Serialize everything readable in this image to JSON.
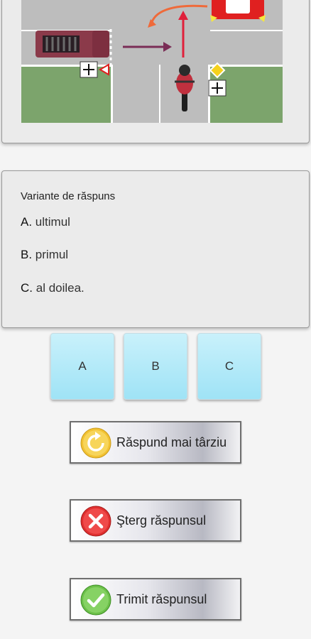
{
  "question_image": {
    "icons": [
      "truck-icon",
      "car-icon",
      "motorcycle-icon",
      "priority-road-sign-icon",
      "junction-sign-icon",
      "yield-sign-icon",
      "arrow-icon"
    ],
    "colors": {
      "road": "#bdbdbd",
      "grass": "#7ca46c",
      "truck": "#8b3a4a",
      "car": "#e02020",
      "arrow_red": "#e0203a",
      "arrow_orange": "#ef6a3a",
      "arrow_purple": "#7a2d56"
    }
  },
  "answers": {
    "title": "Variante de răspuns",
    "options": [
      {
        "letter": "A.",
        "text": "ultimul"
      },
      {
        "letter": "B.",
        "text": "primul"
      },
      {
        "letter": "C.",
        "text": "al doilea."
      }
    ]
  },
  "choices": [
    "A",
    "B",
    "C"
  ],
  "actions": {
    "later": "Răspund mai târziu",
    "clear": "Şterg răspunsul",
    "submit": "Trimit răspunsul"
  },
  "colors": {
    "choice_bg": "#b3ebf9",
    "later_icon": "#f2c233",
    "clear_icon": "#e03030",
    "submit_icon": "#6cc04a"
  }
}
